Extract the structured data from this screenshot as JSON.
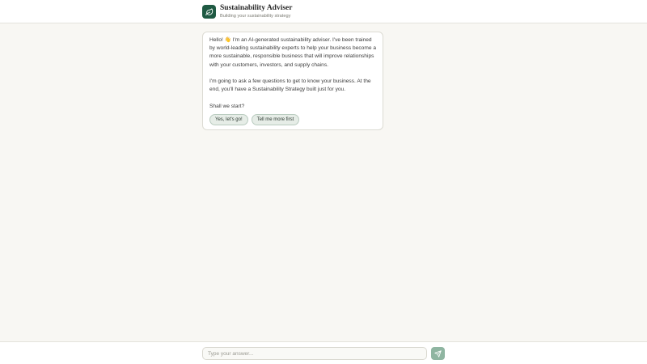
{
  "header": {
    "title": "Sustainability Adviser",
    "subtitle": "Building your sustainability strategy",
    "logo_icon": "leaf-icon"
  },
  "chat": {
    "messages": [
      "Hello! 👋 I'm an AI-generated sustainability adviser. I've been trained by world-leading sustainability experts to help your business become a more sustainable, responsible business that will improve relationships with your customers, investors, and supply chains.",
      "I'm going to ask a few questions to get to know your business. At the end, you'll have a Sustainability Strategy built just for you.",
      "Shall we start?"
    ],
    "choices": [
      "Yes, let's go!",
      "Tell me more first"
    ]
  },
  "composer": {
    "placeholder": "Type your answer...",
    "value": "",
    "send_icon": "send-icon"
  },
  "colors": {
    "brand": "#1f5a43",
    "send_button": "#8fb5a1",
    "choice_bg": "#e6ede7",
    "page_bg": "#f8f7f3"
  }
}
